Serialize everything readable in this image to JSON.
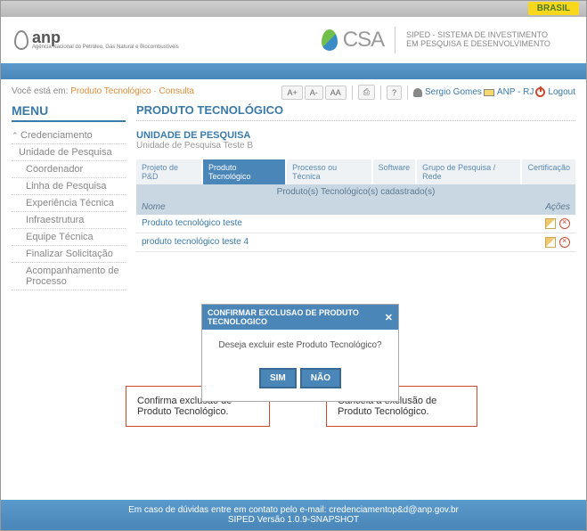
{
  "topbar": {
    "brasil": "BRASIL"
  },
  "header": {
    "anp": {
      "name": "anp",
      "subtitle": "Agência Nacional do Petróleo, Gás Natural e Biocombustíveis"
    },
    "csa": {
      "name": "CSA",
      "line1": "SIPED - SISTEMA DE INVESTIMENTO",
      "line2": "EM PESQUISA E DESENVOLVIMENTO"
    }
  },
  "breadcrumb": {
    "prefix": "Você está em:",
    "link1": "Produto Tecnológico",
    "link2": "Consulta"
  },
  "toolbar": {
    "font_inc": "A+",
    "font_dec": "A-",
    "font_reset": "AA",
    "user": "Sergio Gomes",
    "org": "ANP - RJ",
    "logout": "Logout"
  },
  "sidebar": {
    "title": "MENU",
    "items": [
      {
        "label": "Credenciamento"
      },
      {
        "label": "Unidade de Pesquisa"
      },
      {
        "label": "Coordenador"
      },
      {
        "label": "Linha de Pesquisa"
      },
      {
        "label": "Experiência Técnica"
      },
      {
        "label": "Infraestrutura"
      },
      {
        "label": "Equipe Técnica"
      },
      {
        "label": "Finalizar Solicitação"
      },
      {
        "label": "Acompanhamento de Processo"
      }
    ]
  },
  "page": {
    "title": "PRODUTO TECNOLÓGICO",
    "section_title": "UNIDADE DE PESQUISA",
    "section_sub": "Unidade de Pesquisa Teste B"
  },
  "tabs": [
    {
      "label": "Projeto de P&D"
    },
    {
      "label": "Produto Tecnológico"
    },
    {
      "label": "Processo ou Técnica"
    },
    {
      "label": "Software"
    },
    {
      "label": "Grupo de Pesquisa / Rede"
    },
    {
      "label": "Certificação"
    }
  ],
  "table": {
    "caption": "Produto(s) Tecnológico(s) cadastrado(s)",
    "col_nome": "Nome",
    "col_acoes": "Ações",
    "rows": [
      {
        "name": "Produto tecnológico teste"
      },
      {
        "name": "produto tecnológico teste 4"
      }
    ]
  },
  "modal": {
    "title": "CONFIRMAR EXCLUSAO DE PRODUTO TECNOLOGICO",
    "message": "Deseja excluir este Produto Tecnológico?",
    "yes": "SIM",
    "no": "NÃO"
  },
  "callouts": {
    "confirm": "Confirma exclusão de Produto Tecnológico.",
    "cancel": "Cancela a exclusão de Produto Tecnológico."
  },
  "footer": {
    "line1a": "Em caso de dúvidas entre em contato pelo e-mail: ",
    "mail": "credenciamentop&d@anp.gov.br",
    "line2": "SIPED Versão 1.0.9-SNAPSHOT"
  }
}
